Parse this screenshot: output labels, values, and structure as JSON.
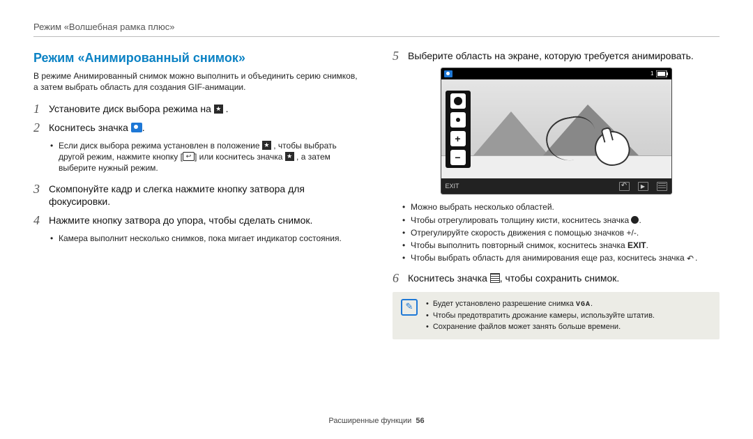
{
  "breadcrumb": "Режим «Волшебная рамка плюс»",
  "heading": "Режим «Анимированный снимок»",
  "intro": "В режиме Анимированный снимок можно выполнить и объединить серию снимков, а затем выбрать область для создания GIF-анимации.",
  "steps": {
    "s1": {
      "num": "1",
      "pre": "Установите диск выбора режима на ",
      "post": " ."
    },
    "s2": {
      "num": "2",
      "pre": "Коснитесь значка ",
      "post": "."
    },
    "s2_sub": {
      "a_pre": "Если диск выбора режима установлен в положение ",
      "a_mid1": " , чтобы выбрать другой режим, нажмите кнопку [",
      "a_mid2": "] или коснитесь значка ",
      "a_post": " , а затем выберите нужный режим."
    },
    "s3": {
      "num": "3",
      "text": "Скомпонуйте кадр и слегка нажмите кнопку затвора для фокусировки."
    },
    "s4": {
      "num": "4",
      "text": "Нажмите кнопку затвора до упора, чтобы сделать снимок."
    },
    "s4_sub": {
      "a": "Камера выполнит несколько снимков, пока мигает индикатор состояния."
    },
    "s5": {
      "num": "5",
      "text": "Выберите область на экране, которую требуется анимировать."
    },
    "s5_sub": {
      "a": "Можно выбрать несколько областей.",
      "b_pre": "Чтобы отрегулировать толщину кисти, коснитесь значка ",
      "b_post": ".",
      "c": "Отрегулируйте скорость движения с помощью значков +/-.",
      "d_pre": "Чтобы выполнить повторный снимок, коснитесь значка ",
      "d_exit": "EXIT",
      "d_post": ".",
      "e_pre": "Чтобы выбрать область для анимирования еще раз, коснитесь значка ",
      "e_post": "."
    },
    "s6": {
      "num": "6",
      "pre": "Коснитесь значка ",
      "post": ", чтобы сохранить снимок."
    }
  },
  "screen": {
    "exit_label": "EXIT",
    "plus": "+",
    "minus": "−",
    "count": "1"
  },
  "note": {
    "a_pre": "Будет установлено разрешение снимка ",
    "a_vga": "VGA",
    "a_post": ".",
    "b": "Чтобы предотвратить дрожание камеры, используйте штатив.",
    "c": "Сохранение файлов может занять больше времени."
  },
  "footer": {
    "section": "Расширенные функции",
    "page": "56"
  }
}
